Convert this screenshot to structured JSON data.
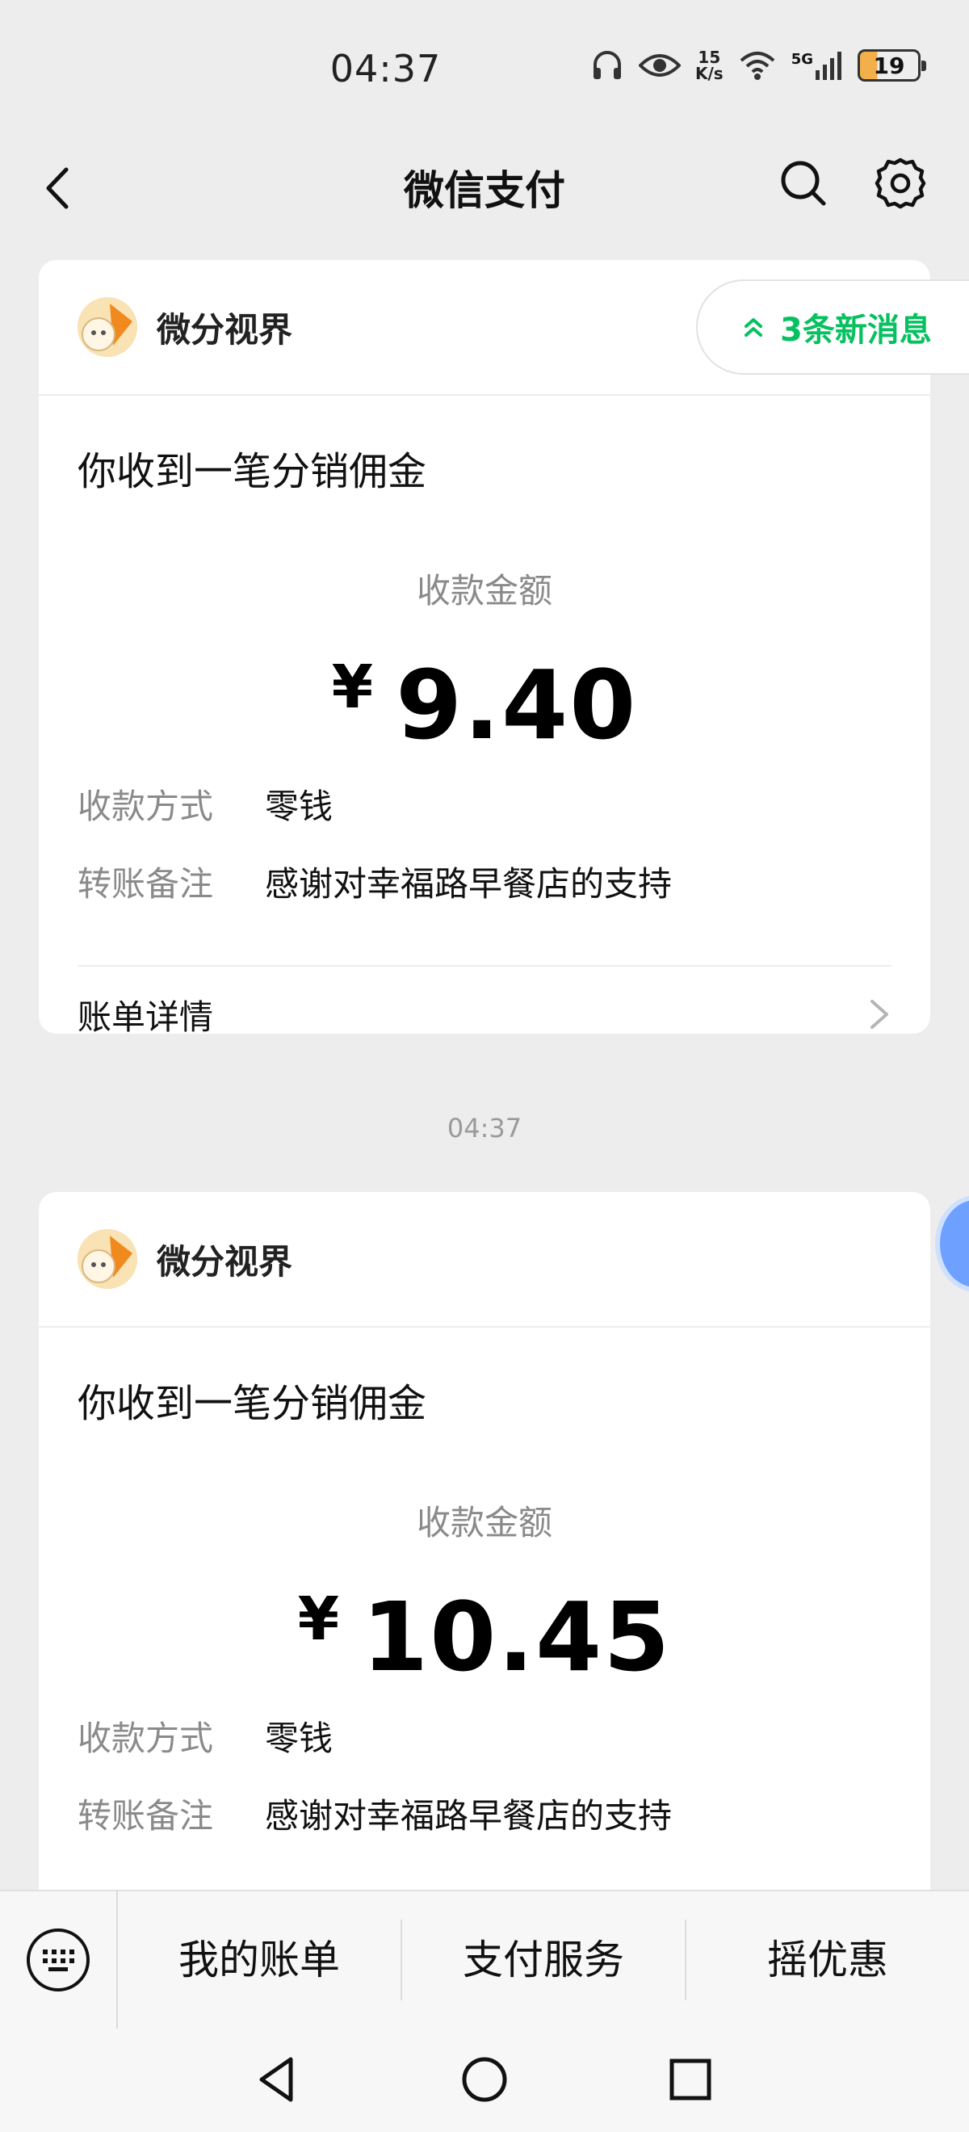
{
  "status_bar": {
    "time": "04:37",
    "net_speed_value": "15",
    "net_speed_unit": "K/s",
    "network": "5G",
    "battery": "19"
  },
  "nav": {
    "title": "微信支付"
  },
  "floating": {
    "new_messages": "3条新消息"
  },
  "messages": [
    {
      "merchant": "微分视界",
      "title": "你收到一笔分销佣金",
      "amount_label": "收款金额",
      "currency": "¥",
      "amount": "9.40",
      "method_label": "收款方式",
      "method_value": "零钱",
      "note_label": "转账备注",
      "note_value": "感谢对幸福路早餐店的支持",
      "bill_label": "账单详情"
    },
    {
      "merchant": "微分视界",
      "title": "你收到一笔分销佣金",
      "amount_label": "收款金额",
      "currency": "¥",
      "amount": "10.45",
      "method_label": "收款方式",
      "method_value": "零钱",
      "note_label": "转账备注",
      "note_value": "感谢对幸福路早餐店的支持"
    }
  ],
  "time_separator": "04:37",
  "bottom_menu": {
    "items": [
      "我的账单",
      "支付服务",
      "摇优惠"
    ]
  },
  "colors": {
    "accent_green": "#07c160",
    "background": "#ededed"
  },
  "icons": [
    "back-arrow-icon",
    "search-icon",
    "gear-icon",
    "keyboard-icon",
    "chevron-right-icon",
    "double-chevron-up-icon"
  ]
}
